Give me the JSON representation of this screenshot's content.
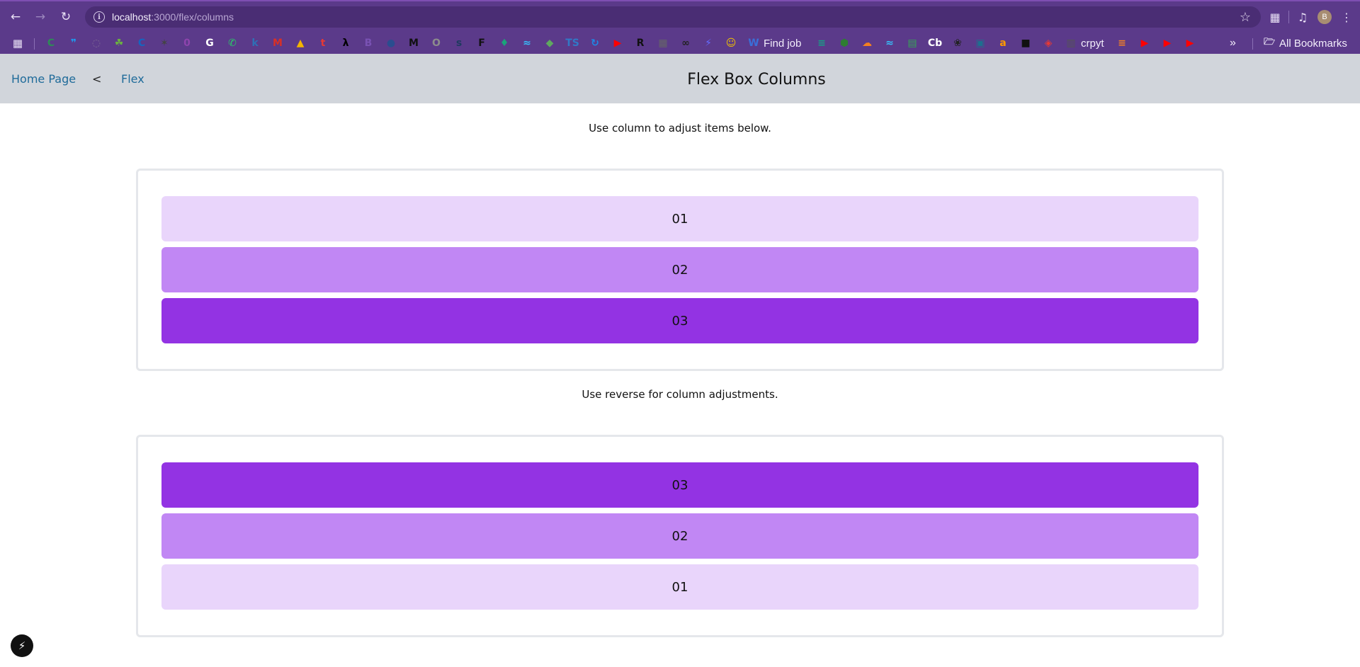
{
  "browser": {
    "url_host": "localhost",
    "url_path": ":3000/flex/columns",
    "profile_initial": "B",
    "bookmarks": [
      {
        "icon": "circle-c-favicon",
        "glyph": "C",
        "color": "#2e8b57",
        "label": ""
      },
      {
        "icon": "bird-favicon",
        "glyph": "❞",
        "color": "#1d9bf0",
        "label": ""
      },
      {
        "icon": "spinner-favicon",
        "glyph": "◌",
        "color": "#7d6a93",
        "label": ""
      },
      {
        "icon": "leaf-favicon",
        "glyph": "☘",
        "color": "#6bb33f",
        "label": ""
      },
      {
        "icon": "c-favicon",
        "glyph": "C",
        "color": "#1565c0",
        "label": ""
      },
      {
        "icon": "cat-favicon",
        "glyph": "✶",
        "color": "#444444",
        "label": ""
      },
      {
        "icon": "purple-favicon",
        "glyph": "0",
        "color": "#8e44ad",
        "label": ""
      },
      {
        "icon": "google-favicon",
        "glyph": "G",
        "color": "#ffffff",
        "label": ""
      },
      {
        "icon": "whatsapp-favicon",
        "glyph": "✆",
        "color": "#25d366",
        "label": ""
      },
      {
        "icon": "k-favicon",
        "glyph": "k",
        "color": "#2f6fb5",
        "label": ""
      },
      {
        "icon": "gmail-favicon",
        "glyph": "M",
        "color": "#d93025",
        "label": ""
      },
      {
        "icon": "drive-favicon",
        "glyph": "▲",
        "color": "#f4b400",
        "label": ""
      },
      {
        "icon": "t-favicon",
        "glyph": "t",
        "color": "#e53935",
        "label": ""
      },
      {
        "icon": "lambda-favicon",
        "glyph": "λ",
        "color": "#000000",
        "label": ""
      },
      {
        "icon": "bootstrap-favicon",
        "glyph": "B",
        "color": "#7952b3",
        "label": ""
      },
      {
        "icon": "globe-favicon",
        "glyph": "●",
        "color": "#2a4d8f",
        "label": ""
      },
      {
        "icon": "m-favicon",
        "glyph": "M",
        "color": "#111111",
        "label": ""
      },
      {
        "icon": "o-favicon",
        "glyph": "O",
        "color": "#8c8c8c",
        "label": ""
      },
      {
        "icon": "solar-favicon",
        "glyph": "s",
        "color": "#1e3a5f",
        "label": ""
      },
      {
        "icon": "f-favicon",
        "glyph": "F",
        "color": "#111111",
        "label": ""
      },
      {
        "icon": "figma-favicon",
        "glyph": "♦",
        "color": "#1aa37a",
        "label": ""
      },
      {
        "icon": "wave-favicon",
        "glyph": "≈",
        "color": "#38bdf8",
        "label": ""
      },
      {
        "icon": "green-favicon",
        "glyph": "◆",
        "color": "#5fa85f",
        "label": ""
      },
      {
        "icon": "ts-favicon",
        "glyph": "TS",
        "color": "#3178c6",
        "label": ""
      },
      {
        "icon": "refresh-favicon",
        "glyph": "↻",
        "color": "#1e88e5",
        "label": ""
      },
      {
        "icon": "youtube-favicon",
        "glyph": "▶",
        "color": "#ff0000",
        "label": ""
      },
      {
        "icon": "rrd-favicon",
        "glyph": "R",
        "color": "#111111",
        "label": ""
      },
      {
        "icon": "grid-favicon",
        "glyph": "▦",
        "color": "#666666",
        "label": ""
      },
      {
        "icon": "glasses-favicon",
        "glyph": "∞",
        "color": "#222222",
        "label": ""
      },
      {
        "icon": "vite-favicon",
        "glyph": "⚡",
        "color": "#646cff",
        "label": ""
      },
      {
        "icon": "smiley-favicon",
        "glyph": "☺",
        "color": "#f0c000",
        "label": ""
      },
      {
        "icon": "w-favicon",
        "glyph": "W",
        "color": "#3a6fd8",
        "label": "Find job"
      },
      {
        "icon": "stack-favicon",
        "glyph": "≡",
        "color": "#16a085",
        "label": ""
      },
      {
        "icon": "node-favicon",
        "glyph": "⬢",
        "color": "#2e7d32",
        "label": ""
      },
      {
        "icon": "cloud-favicon",
        "glyph": "☁",
        "color": "#f38020",
        "label": ""
      },
      {
        "icon": "tailwind-favicon",
        "glyph": "≈",
        "color": "#38bdf8",
        "label": ""
      },
      {
        "icon": "map-favicon",
        "glyph": "▤",
        "color": "#34a853",
        "label": ""
      },
      {
        "icon": "cb-favicon",
        "glyph": "Cb",
        "color": "#ffffff",
        "label": ""
      },
      {
        "icon": "openai-favicon",
        "glyph": "❀",
        "color": "#222222",
        "label": ""
      },
      {
        "icon": "robot-favicon",
        "glyph": "▣",
        "color": "#1d6f8f",
        "label": ""
      },
      {
        "icon": "amazon-favicon",
        "glyph": "a",
        "color": "#ff9900",
        "label": ""
      },
      {
        "icon": "dark-favicon",
        "glyph": "■",
        "color": "#111111",
        "label": ""
      },
      {
        "icon": "cube-favicon",
        "glyph": "◈",
        "color": "#e53935",
        "label": ""
      },
      {
        "icon": "sheet-favicon",
        "glyph": "▥",
        "color": "#555555",
        "label": "crpyt"
      },
      {
        "icon": "stack-overflow-favicon",
        "glyph": "≡",
        "color": "#f48024",
        "label": ""
      },
      {
        "icon": "youtube-favicon",
        "glyph": "▶",
        "color": "#ff0000",
        "label": ""
      },
      {
        "icon": "youtube-favicon",
        "glyph": "▶",
        "color": "#ff0000",
        "label": ""
      },
      {
        "icon": "youtube-favicon",
        "glyph": "▶",
        "color": "#ff0000",
        "label": ""
      }
    ],
    "all_bookmarks_label": "All Bookmarks"
  },
  "navbar": {
    "home_label": "Home Page",
    "separator": "<",
    "flex_label": "Flex",
    "title": "Flex Box Columns"
  },
  "sections": [
    {
      "instruction": "Use column to adjust items below.",
      "direction": "column",
      "items": [
        {
          "label": "01",
          "color": "#e9d5fb"
        },
        {
          "label": "02",
          "color": "#c187f4"
        },
        {
          "label": "03",
          "color": "#9333e3"
        }
      ]
    },
    {
      "instruction": "Use reverse for column adjustments.",
      "direction": "column-reverse",
      "items": [
        {
          "label": "01",
          "color": "#e9d5fb"
        },
        {
          "label": "02",
          "color": "#c187f4"
        },
        {
          "label": "03",
          "color": "#9333e3"
        }
      ]
    }
  ],
  "colors": {
    "browser_frame": "#5b3a8a",
    "navbar_bg": "#d1d5db",
    "link": "#1f6b9a",
    "panel_border": "#e5e7eb"
  }
}
